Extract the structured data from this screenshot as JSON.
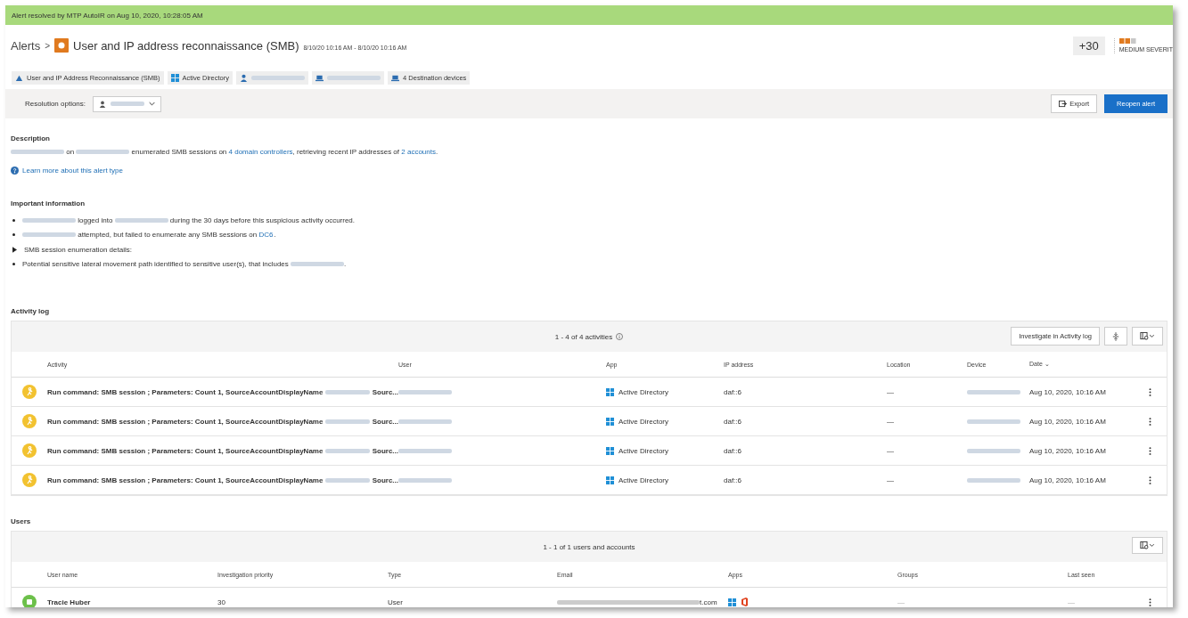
{
  "banner": {
    "text": "Alert resolved by MTP AutoIR on Aug 10, 2020, 10:28:05 AM"
  },
  "header": {
    "breadcrumb": "Alerts",
    "separator": ">",
    "title": "User and IP address reconnaissance (SMB)",
    "time_range": "8/10/20 10:16 AM - 8/10/20 10:16 AM",
    "score": "+30",
    "severity": {
      "label": "MEDIUM SEVERIT",
      "level": 0.67
    }
  },
  "tags": [
    {
      "kind": "alert",
      "label": "User and IP Address Reconnaissance (SMB)"
    },
    {
      "kind": "windows",
      "label": "Active Directory"
    },
    {
      "kind": "user",
      "redacted": true
    },
    {
      "kind": "device",
      "redacted": true
    },
    {
      "kind": "device",
      "label": "4 Destination devices"
    }
  ],
  "resolution": {
    "label": "Resolution options:",
    "buttons": [
      {
        "kind": "secondary",
        "label": "Export"
      },
      {
        "kind": "primary",
        "label": "Reopen alert"
      }
    ]
  },
  "description": {
    "heading": "Description",
    "parts": [
      {
        "kind": "redacted"
      },
      {
        "kind": "text",
        "text": " on "
      },
      {
        "kind": "redacted"
      },
      {
        "kind": "text",
        "text": " enumerated SMB sessions on "
      },
      {
        "kind": "link",
        "text": "4 domain controllers"
      },
      {
        "kind": "text",
        "text": ", retrieving recent IP addresses of "
      },
      {
        "kind": "link",
        "text": "2 accounts"
      },
      {
        "kind": "text",
        "text": "."
      }
    ],
    "learn_more": "Learn more about this alert type"
  },
  "important": {
    "heading": "Important information",
    "items": [
      {
        "kind": "bullet",
        "parts": [
          {
            "kind": "redacted"
          },
          {
            "kind": "text",
            "text": " logged into "
          },
          {
            "kind": "redacted"
          },
          {
            "kind": "text",
            "text": " during the 30 days before this suspicious activity occurred."
          }
        ]
      },
      {
        "kind": "bullet",
        "parts": [
          {
            "kind": "redacted"
          },
          {
            "kind": "text",
            "text": " attempted, but failed to enumerate any SMB sessions on "
          },
          {
            "kind": "link",
            "text": "DC6"
          },
          {
            "kind": "text",
            "text": "."
          }
        ]
      },
      {
        "kind": "expander",
        "expanded": false,
        "parts": [
          {
            "kind": "text",
            "text": "SMB session enumeration details:"
          }
        ]
      },
      {
        "kind": "bullet",
        "parts": [
          {
            "kind": "text",
            "text": "Potential sensitive lateral movement path identified to sensitive user(s), that includes "
          },
          {
            "kind": "redacted"
          },
          {
            "kind": "text",
            "text": "."
          }
        ]
      }
    ]
  },
  "activity_log": {
    "heading": "Activity log",
    "count": "1 - 4 of 4 activities",
    "investigate": "Investigate in Activity log",
    "columns": [
      "Activity",
      "User",
      "App",
      "IP address",
      "Location",
      "Device",
      "Date"
    ],
    "sort_mark": "⌄",
    "rows": [
      {
        "activity": "Run command: SMB session ; Parameters: Count 1, SourceAccountDisplayName",
        "activity_end": "Sourc...",
        "app": "Active Directory",
        "ip": "daf::6",
        "location": "—",
        "date": "Aug 10, 2020, 10:16 AM"
      },
      {
        "activity": "Run command: SMB session ; Parameters: Count 1, SourceAccountDisplayName",
        "activity_end": "Sourc...",
        "app": "Active Directory",
        "ip": "daf::6",
        "location": "—",
        "date": "Aug 10, 2020, 10:16 AM"
      },
      {
        "activity": "Run command: SMB session ; Parameters: Count 1, SourceAccountDisplayName",
        "activity_end": "Sourc...",
        "app": "Active Directory",
        "ip": "daf::6",
        "location": "—",
        "date": "Aug 10, 2020, 10:16 AM"
      },
      {
        "activity": "Run command: SMB session ; Parameters: Count 1, SourceAccountDisplayName",
        "activity_end": "Sourc...",
        "app": "Active Directory",
        "ip": "daf::6",
        "location": "—",
        "date": "Aug 10, 2020, 10:16 AM"
      }
    ]
  },
  "users": {
    "heading": "Users",
    "count": "1 - 1 of 1 users and accounts",
    "columns": [
      "User name",
      "Investigation priority",
      "Type",
      "Email",
      "Apps",
      "Groups",
      "Last seen"
    ],
    "rows": [
      {
        "name": "Tracie Huber",
        "priority": "30",
        "type": "User",
        "email_end": "t.com",
        "groups": "—",
        "last_seen": "—"
      }
    ]
  }
}
